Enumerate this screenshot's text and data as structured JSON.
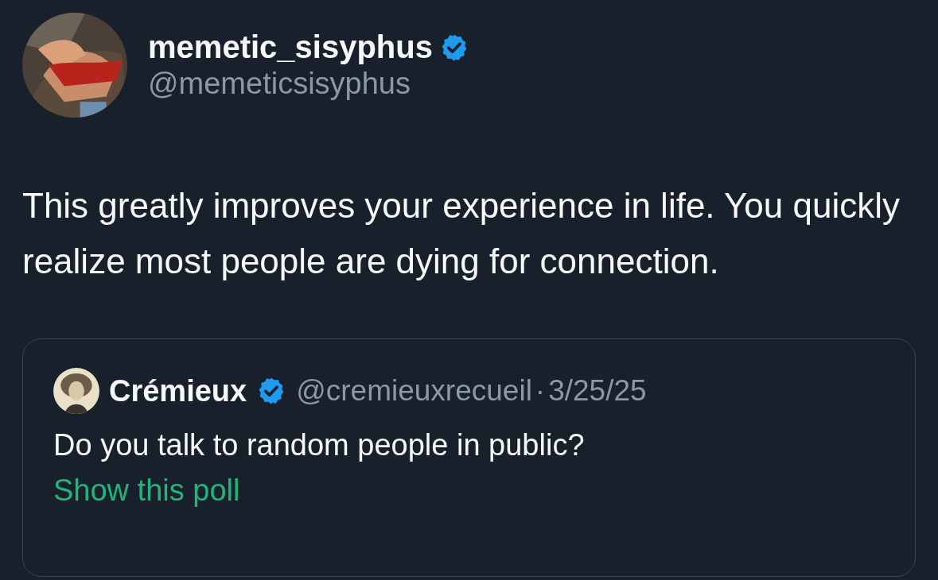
{
  "author": {
    "name": "memetic_sisyphus",
    "verified": true,
    "handle": "@memeticsisyphus"
  },
  "text": "This greatly improves your experience in life. You quickly realize most people are dying for connection.",
  "quoted": {
    "author": {
      "name": "Crémieux",
      "verified": true,
      "handle": "@cremieuxrecueil"
    },
    "separator": "·",
    "date": "3/25/25",
    "text": "Do you talk to random people in public?",
    "poll_link": "Show this poll"
  }
}
